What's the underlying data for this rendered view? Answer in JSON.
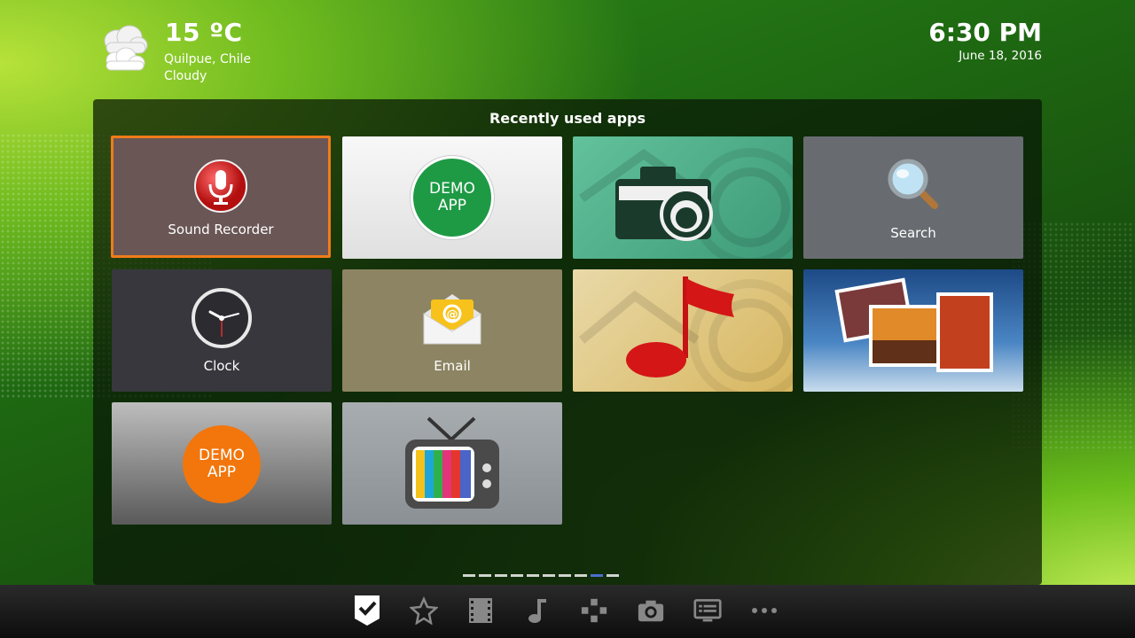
{
  "weather": {
    "temperature": "15 ºC",
    "location": "Quilpue, Chile",
    "condition": "Cloudy",
    "icon": "cloud-icon"
  },
  "clock": {
    "time": "6:30 PM",
    "date": "June 18, 2016"
  },
  "panel": {
    "title": "Recently used apps",
    "apps": [
      {
        "label": "Sound Recorder",
        "icon": "microphone-icon",
        "focused": true
      },
      {
        "label": "",
        "icon_text": "DEMO APP",
        "icon": "demo-app-green-icon"
      },
      {
        "label": "",
        "icon": "camera-icon"
      },
      {
        "label": "Search",
        "icon": "magnifier-icon"
      },
      {
        "label": "Clock",
        "icon": "clock-icon"
      },
      {
        "label": "Email",
        "icon": "email-icon"
      },
      {
        "label": "",
        "icon": "music-note-icon"
      },
      {
        "label": "",
        "icon": "gallery-icon"
      },
      {
        "label": "",
        "icon_text": "DEMO APP",
        "icon": "demo-app-orange-icon"
      },
      {
        "label": "",
        "icon": "tv-icon"
      }
    ]
  },
  "pager": {
    "pages": 10,
    "active_index": 8
  },
  "navbar": {
    "items": [
      "check-icon",
      "star-icon",
      "film-icon",
      "music-icon",
      "gamepad-icon",
      "camera-icon",
      "list-icon",
      "more-icon"
    ],
    "active": "check-icon"
  },
  "colors": {
    "focus": "#f07c1a",
    "pager_active": "#4a6fd0",
    "demo_green": "#1e9a45",
    "demo_orange": "#f2760c"
  }
}
